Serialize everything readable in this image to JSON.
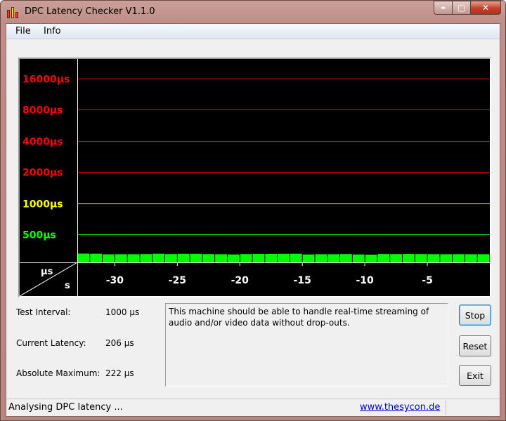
{
  "window": {
    "title": "DPC Latency Checker V1.1.0"
  },
  "caption_buttons": {
    "minimize": "▬",
    "maximize": "▢",
    "close": "✕"
  },
  "menu": [
    {
      "label": "File"
    },
    {
      "label": "Info"
    }
  ],
  "chart_data": {
    "type": "bar",
    "y_scale": "log2",
    "ylabels": [
      {
        "label": "16000µs",
        "value": 16000,
        "color": "#ff0000"
      },
      {
        "label": "8000µs",
        "value": 8000,
        "color": "#ff0000"
      },
      {
        "label": "4000µs",
        "value": 4000,
        "color": "#ff0000"
      },
      {
        "label": "2000µs",
        "value": 2000,
        "color": "#ff0000"
      },
      {
        "label": "1000µs",
        "value": 1000,
        "color": "#ffff00"
      },
      {
        "label": "500µs",
        "value": 500,
        "color": "#00ff00"
      }
    ],
    "corner_ylabel": "µs",
    "corner_xlabel": "s",
    "xticks": [
      "-30",
      "-25",
      "-20",
      "-15",
      "-10",
      "-5"
    ],
    "xtick_values": [
      -30,
      -25,
      -20,
      -15,
      -10,
      -5
    ],
    "xlim": [
      -33,
      0
    ],
    "bar_color": "#00ff00",
    "values": [
      225,
      222,
      210,
      212,
      212,
      214,
      222,
      214,
      220,
      220,
      214,
      212,
      208,
      214,
      218,
      218,
      220,
      222,
      208,
      212,
      212,
      214,
      208,
      205,
      215,
      214,
      216,
      214,
      213,
      212,
      213,
      212,
      212
    ]
  },
  "info": {
    "test_interval_label": "Test Interval:",
    "test_interval_value": "1000 µs",
    "current_latency_label": "Current Latency:",
    "current_latency_value": "206 µs",
    "absolute_maximum_label": "Absolute Maximum:",
    "absolute_maximum_value": "222 µs"
  },
  "message": "This machine should be able to handle real-time streaming of audio and/or video data without drop-outs.",
  "buttons": {
    "stop": "Stop",
    "reset": "Reset",
    "exit": "Exit"
  },
  "status": {
    "text": "Analysing DPC latency ...",
    "link": "www.thesycon.de"
  }
}
